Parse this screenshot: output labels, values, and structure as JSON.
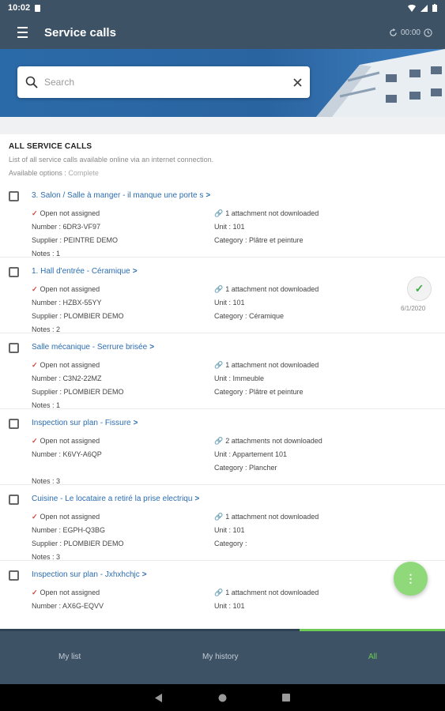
{
  "status_bar": {
    "time": "10:02"
  },
  "app_bar": {
    "title": "Service calls",
    "timer": "00:00"
  },
  "search": {
    "placeholder": "Search"
  },
  "list_header": {
    "title": "ALL SERVICE CALLS",
    "description": "List of all service calls available online via an internet connection.",
    "options_label": "Available options : ",
    "options_value": "Complete"
  },
  "items": [
    {
      "title": "3. Salon / Salle à manger - il manque une porte s",
      "status": "Open not assigned",
      "number": "Number : 6DR3-VF97",
      "supplier": "Supplier : PEINTRE DEMO",
      "notes": "Notes : 1",
      "attachment": "1 attachment not downloaded",
      "unit": "Unit : 101",
      "category": "Category : Plâtre et peinture"
    },
    {
      "title": "1. Hall d'entrée - Céramique",
      "status": "Open not assigned",
      "number": "Number : HZBX-55YY",
      "supplier": "Supplier : PLOMBIER DEMO",
      "notes": "Notes : 2",
      "attachment": "1 attachment not downloaded",
      "unit": "Unit : 101",
      "category": "Category : Céramique",
      "completed_date": "6/1/2020"
    },
    {
      "title": "Salle mécanique - Serrure brisée",
      "status": "Open not assigned",
      "number": "Number : C3N2-22MZ",
      "supplier": "Supplier : PLOMBIER DEMO",
      "notes": "Notes : 1",
      "attachment": "1 attachment not downloaded",
      "unit": "Unit : Immeuble",
      "category": "Category : Plâtre et peinture"
    },
    {
      "title": "Inspection sur plan - Fissure",
      "status": "Open not assigned",
      "number": "Number : K6VY-A6QP",
      "supplier": "",
      "notes": "Notes : 3",
      "attachment": "2 attachments not downloaded",
      "unit": "Unit : Appartement 101",
      "category": "Category : Plancher"
    },
    {
      "title": "Cuisine - Le locataire a retiré la prise electriqu",
      "status": "Open not assigned",
      "number": "Number : EGPH-Q3BG",
      "supplier": "Supplier : PLOMBIER DEMO",
      "notes": "Notes : 3",
      "attachment": "1 attachment not downloaded",
      "unit": "Unit : 101",
      "category": "Category :"
    },
    {
      "title": "Inspection sur plan - Jxhxhchjc",
      "status": "Open not assigned",
      "number": "Number : AX6G-EQVV",
      "supplier": "",
      "notes": "",
      "attachment": "1 attachment not downloaded",
      "unit": "Unit : 101",
      "category": ""
    }
  ],
  "fab": {
    "icon": "⋮"
  },
  "bottom_nav": {
    "tab1": "My list",
    "tab2": "My history",
    "tab3": "All"
  },
  "colors": {
    "primary": "#3e5266",
    "accent": "#6ccc55",
    "link": "#2c6db1",
    "check": "#d9443b"
  },
  "icons": [
    "menu-icon",
    "timer-refresh-icon",
    "clock-icon",
    "search-icon",
    "clear-icon",
    "checkmark-icon",
    "attachment-link-icon",
    "chevron-right-icon",
    "completed-check-icon",
    "more-vert-icon",
    "back-icon",
    "home-icon",
    "recents-icon"
  ]
}
